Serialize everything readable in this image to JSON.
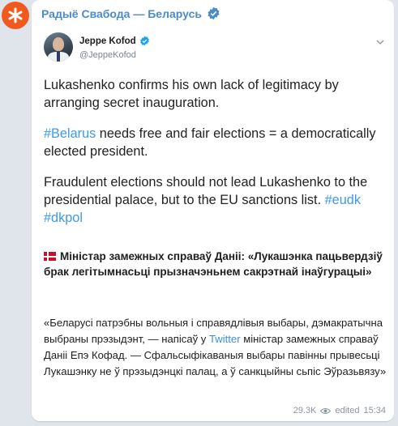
{
  "channel": {
    "name": "Радыё Свабода — Беларусь",
    "avatar_glyph": "✳",
    "accent_color": "#f05a1f",
    "name_color": "#4a8cc7",
    "verified_icon": "verified-badge-icon"
  },
  "tweet": {
    "author_name": "Jeppe Kofod",
    "author_handle": "@JeppeKofod",
    "verified_icon": "verified-badge-icon",
    "menu_icon": "chevron-down-icon",
    "p1": "Lukashenko confirms his own lack of legitimacy by arranging secret inauguration.",
    "p2_tag": "#Belarus",
    "p2_rest": " needs free and fair elections = a democratically elected president.",
    "p3_text": "Fraudulent elections should not lead Lukashenko to the presidential palace, but to the EU sanctions list. ",
    "p3_tag1": "#eudk",
    "p3_tag2": "#dkpol",
    "hashtag_color": "#3d9ae8"
  },
  "article": {
    "flag_icon": "denmark-flag-icon",
    "title": "Міністар замежных справаў Даніі: «Лукашэнка пацьвердзіў брак легітымнасьці прызначэньнем сакрэтнай інаўгурацыі»"
  },
  "quote": {
    "before_link": "«Беларусі патрэбны вольныя і справядлівыя выбары, дэмакратычна выбраны прэзыдэнт, — напісаў у ",
    "link": "Twitter",
    "after_link": " міністар замежных справаў Даніі Епэ Кофад. — Сфальсыфікаваныя выбары павінны прывесьці Лукашэнку не ў прэзыдэнцкі палац, а ў санкцыйны сьпіс Эўразьвязу»"
  },
  "meta": {
    "views": "29.3K",
    "view_icon": "eye-icon",
    "edited": "edited",
    "time": "15:34"
  }
}
